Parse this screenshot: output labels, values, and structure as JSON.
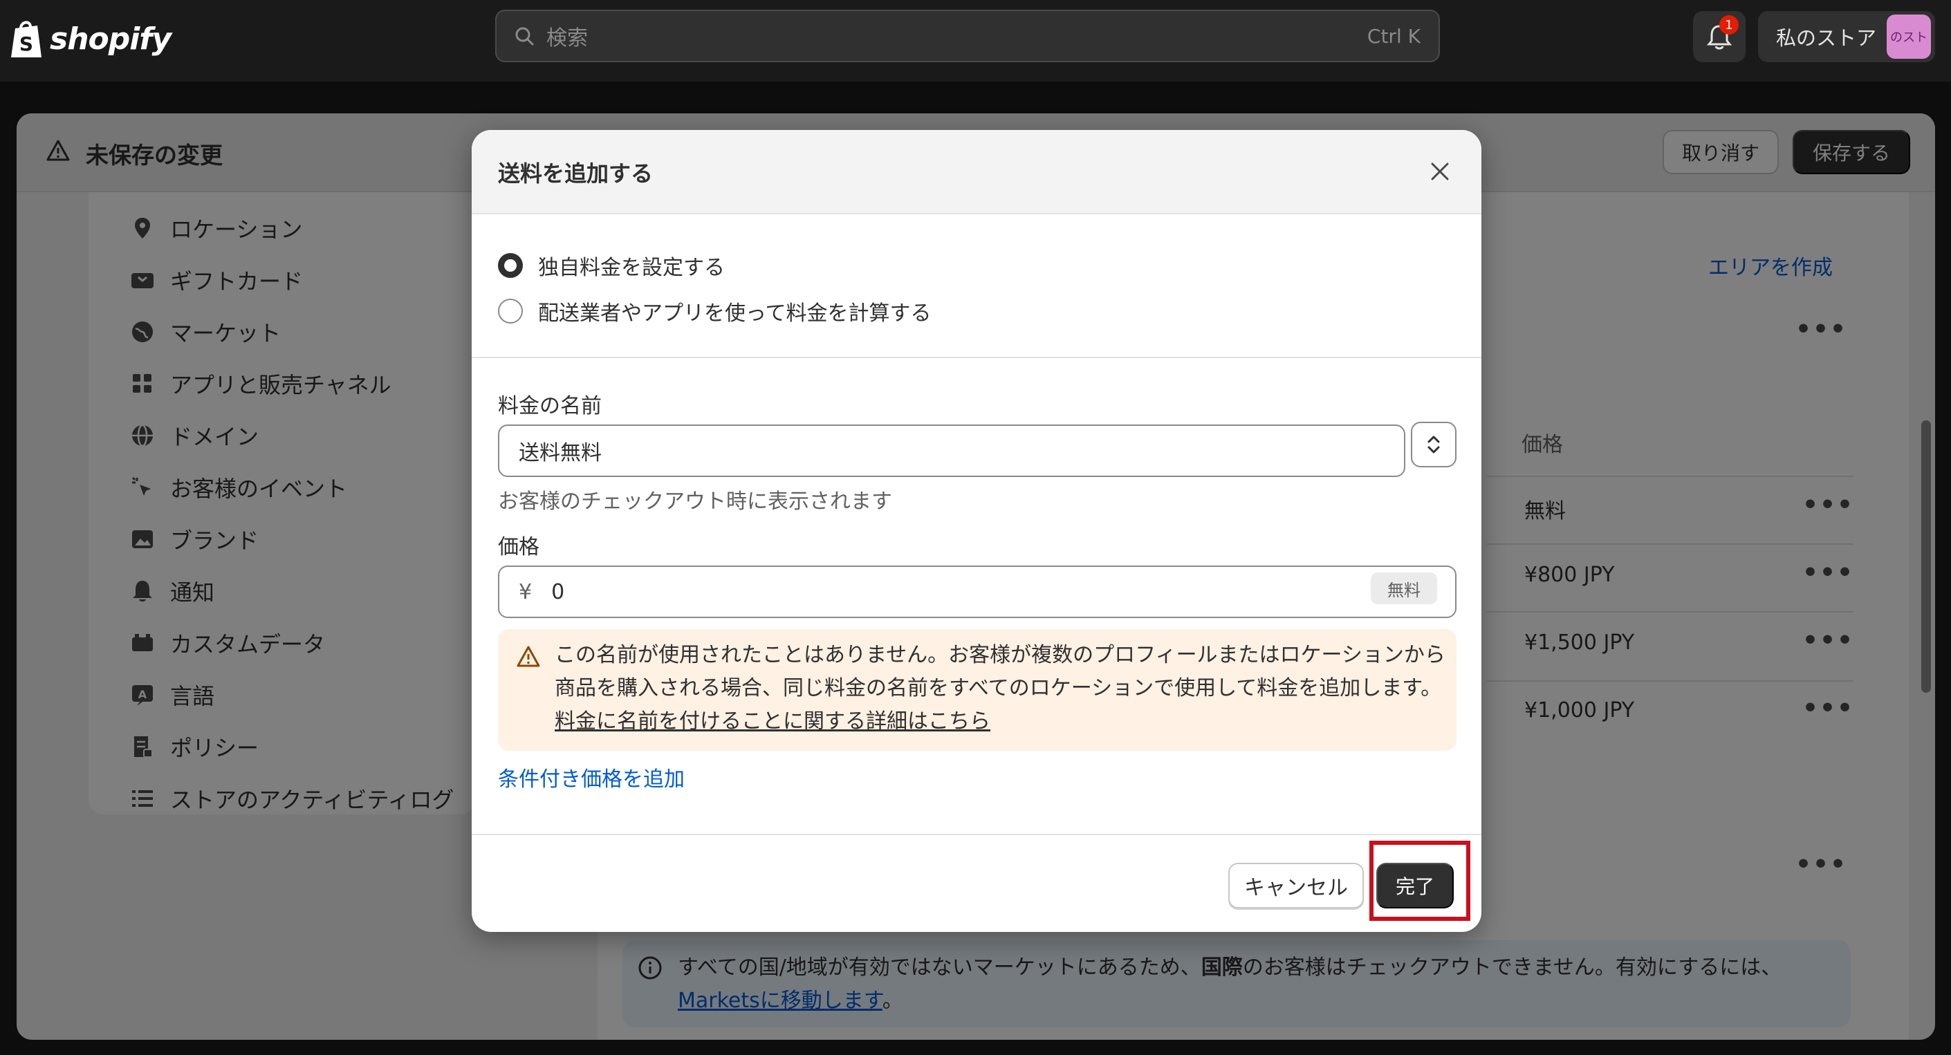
{
  "topbar": {
    "logo_text": "shopify",
    "search_placeholder": "検索",
    "search_shortcut": "Ctrl K",
    "notification_count": "1",
    "store_name": "私のストア",
    "store_avatar_text": "のスト"
  },
  "savebar": {
    "title": "未保存の変更",
    "discard_label": "取り消す",
    "save_label": "保存する"
  },
  "sidebar": {
    "items": [
      {
        "label": "ロケーション",
        "icon": "location-pin-icon"
      },
      {
        "label": "ギフトカード",
        "icon": "gift-card-icon"
      },
      {
        "label": "マーケット",
        "icon": "globe-icon"
      },
      {
        "label": "アプリと販売チャネル",
        "icon": "apps-icon"
      },
      {
        "label": "ドメイン",
        "icon": "domain-globe-icon"
      },
      {
        "label": "お客様のイベント",
        "icon": "cursor-click-icon"
      },
      {
        "label": "ブランド",
        "icon": "brand-image-icon"
      },
      {
        "label": "通知",
        "icon": "bell-icon"
      },
      {
        "label": "カスタムデータ",
        "icon": "database-icon"
      },
      {
        "label": "言語",
        "icon": "language-icon"
      },
      {
        "label": "ポリシー",
        "icon": "policy-icon"
      },
      {
        "label": "ストアのアクティビティログ",
        "icon": "list-icon"
      }
    ]
  },
  "main": {
    "create_area_link": "エリアを作成",
    "price_column": "価格",
    "prices": [
      "無料",
      "¥800 JPY",
      "¥1,500 JPY",
      "¥1,000 JPY"
    ],
    "info_banner": {
      "text_1": "すべての国/地域が有効ではないマーケットにあるため、",
      "text_bold": "国際",
      "text_2": "のお客様はチェックアウトできません。有効にするには、",
      "link": "Marketsに移動します",
      "text_end": "。"
    }
  },
  "modal": {
    "title": "送料を追加する",
    "radio_custom": "独自料金を設定する",
    "radio_carrier": "配送業者やアプリを使って料金を計算する",
    "rate_name_label": "料金の名前",
    "rate_name_value": "送料無料",
    "rate_name_helper": "お客様のチェックアウト時に表示されます",
    "price_label": "価格",
    "price_prefix": "¥",
    "price_value": "0",
    "price_badge": "無料",
    "warning_text": "この名前が使用されたことはありません。お客様が複数のプロフィールまたはロケーションから商品を購入される場合、同じ料金の名前をすべてのロケーションで使用して料金を追加します。",
    "warning_link": "料金に名前を付けることに関する詳細はこちら",
    "conditional_link": "条件付き価格を追加",
    "cancel_label": "キャンセル",
    "done_label": "完了"
  }
}
